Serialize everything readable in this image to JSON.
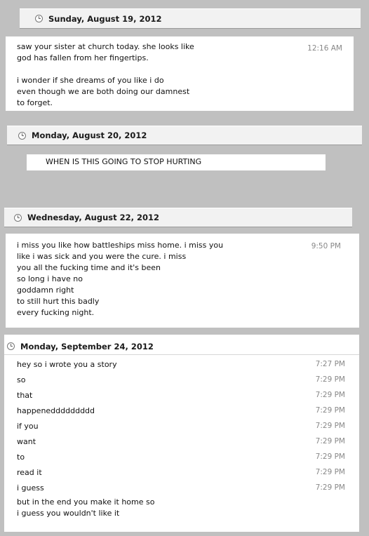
{
  "entries": [
    {
      "date": "Sunday, August 19, 2012",
      "message": "saw your sister at church today. she looks like\ngod has fallen from her fingertips.\n\ni wonder if she dreams of you like i do\neven though we are both doing our damnest\nto forget.",
      "time": "12:16 AM"
    },
    {
      "date": "Monday, August 20, 2012",
      "message": "WHEN IS THIS GOING TO STOP HURTING"
    },
    {
      "date": "Wednesday, August 22, 2012",
      "message": "i miss you like how battleships miss home. i miss you\nlike i was sick and you were the cure. i miss\nyou all the fucking time and it's been\nso long i have no\ngoddamn right\nto still hurt this badly\nevery fucking night.",
      "time": "9:50 PM"
    },
    {
      "date": "Monday, September 24, 2012",
      "lines": [
        {
          "text": "hey so i wrote you a story",
          "time": "7:27 PM"
        },
        {
          "text": "so",
          "time": "7:29 PM"
        },
        {
          "text": "that",
          "time": "7:29 PM"
        },
        {
          "text": "happeneddddddddd",
          "time": "7:29 PM"
        },
        {
          "text": "if you",
          "time": "7:29 PM"
        },
        {
          "text": "want",
          "time": "7:29 PM"
        },
        {
          "text": "to",
          "time": "7:29 PM"
        },
        {
          "text": "read it",
          "time": "7:29 PM"
        },
        {
          "text": "i guess",
          "time": "7:29 PM"
        }
      ],
      "closing": "but in the end you make it home so\ni guess you wouldn't like it"
    }
  ]
}
